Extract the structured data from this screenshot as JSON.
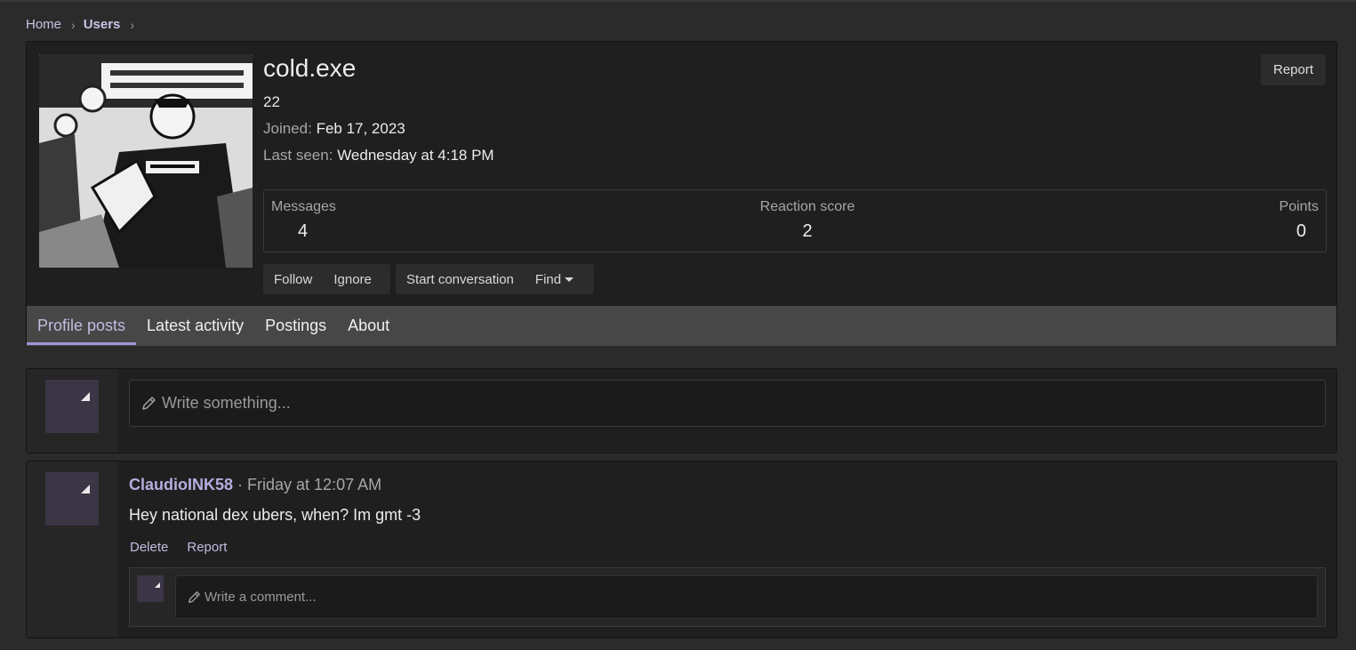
{
  "breadcrumb": {
    "home": "Home",
    "users": "Users"
  },
  "profile": {
    "username": "cold.exe",
    "title": "22",
    "joined_label": "Joined:",
    "joined_value": "Feb 17, 2023",
    "lastseen_label": "Last seen:",
    "lastseen_value": "Wednesday at 4:18 PM",
    "report_label": "Report",
    "stats": {
      "messages_label": "Messages",
      "messages_value": "4",
      "reaction_label": "Reaction score",
      "reaction_value": "2",
      "points_label": "Points",
      "points_value": "0"
    },
    "buttons": {
      "follow": "Follow",
      "ignore": "Ignore",
      "start_conversation": "Start conversation",
      "find": "Find"
    }
  },
  "tabs": [
    "Profile posts",
    "Latest activity",
    "Postings",
    "About"
  ],
  "composer": {
    "placeholder": "Write something..."
  },
  "post": {
    "author": "ClaudioINK58",
    "time": " · Friday at 12:07 AM",
    "body": "Hey national dex ubers, when? Im gmt -3",
    "delete_label": "Delete",
    "report_label": "Report",
    "comment_placeholder": "Write a comment..."
  },
  "colors": {
    "accent": "#9f97d6",
    "link": "#c2bce0",
    "background": "#2b2b2b",
    "panel": "#1f1f1f"
  },
  "icons": {
    "pencil": "pencil-icon",
    "chevron": "chevron-right-icon",
    "caret": "caret-down-icon"
  }
}
